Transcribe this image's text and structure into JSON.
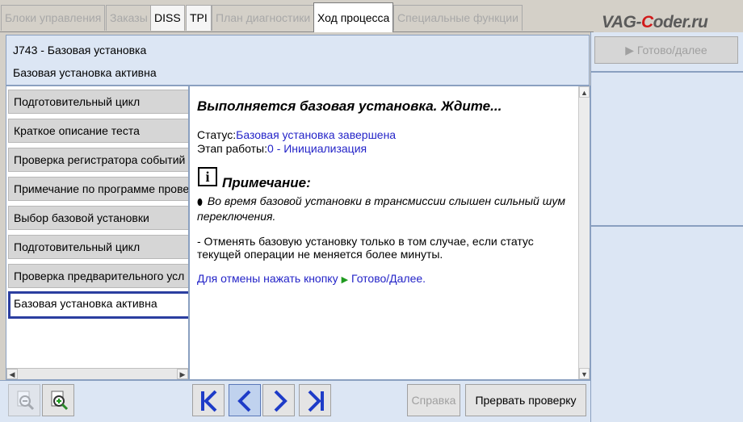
{
  "tabs": [
    {
      "label": "Блоки управления",
      "state": "disabled"
    },
    {
      "label": "Заказы",
      "state": "disabled"
    },
    {
      "label": "DISS",
      "state": "enabled"
    },
    {
      "label": "TPI",
      "state": "enabled"
    },
    {
      "label": "План диагностики",
      "state": "disabled"
    },
    {
      "label": "Ход процесса",
      "state": "active"
    },
    {
      "label": "Специальные функции",
      "state": "disabled"
    }
  ],
  "logo": {
    "pre": "VAG-",
    "accent": "C",
    "post": "oder.ru"
  },
  "header": {
    "line1": "J743 - Базовая установка",
    "line2": "Базовая установка активна"
  },
  "steps": [
    {
      "label": "Подготовительный цикл"
    },
    {
      "label": "Краткое описание теста"
    },
    {
      "label": "Проверка регистратора событий"
    },
    {
      "label": "Примечание по программе прове"
    },
    {
      "label": "Выбор базовой установки"
    },
    {
      "label": "Подготовительный цикл"
    },
    {
      "label": "Проверка предварительного усл"
    },
    {
      "label": "Базовая установка активна"
    }
  ],
  "content": {
    "title": "Выполняется базовая установка. Ждите...",
    "status_label": "Статус:",
    "status_value": "Базовая установка завершена",
    "stage_label": "Этап работы:",
    "stage_value": "0 - Инициализация",
    "note_icon_letter": "i",
    "note_heading": "Примечание:",
    "note_bullet": "Во время базовой установки в трансмиссии слышен сильный шум переключения.",
    "note_text2": "- Отменять базовую установку только в том случае, если статус текущей операции не меняется более минуты.",
    "cancel_hint_text": "Для отмены нажать кнопку",
    "cancel_hint_button": "Готово/Далее."
  },
  "right_panel": {
    "go_button": "▶  Готово/далее"
  },
  "bottom": {
    "help_button": "Справка",
    "abort_button": "Прервать проверку"
  },
  "colors": {
    "accent_blue": "#2424c8",
    "panel_bg": "#dce6f4",
    "active_step_border": "#2b3ea0",
    "nav_arrow": "#1e3cc8",
    "hint_triangle": "#1f9a1f"
  }
}
